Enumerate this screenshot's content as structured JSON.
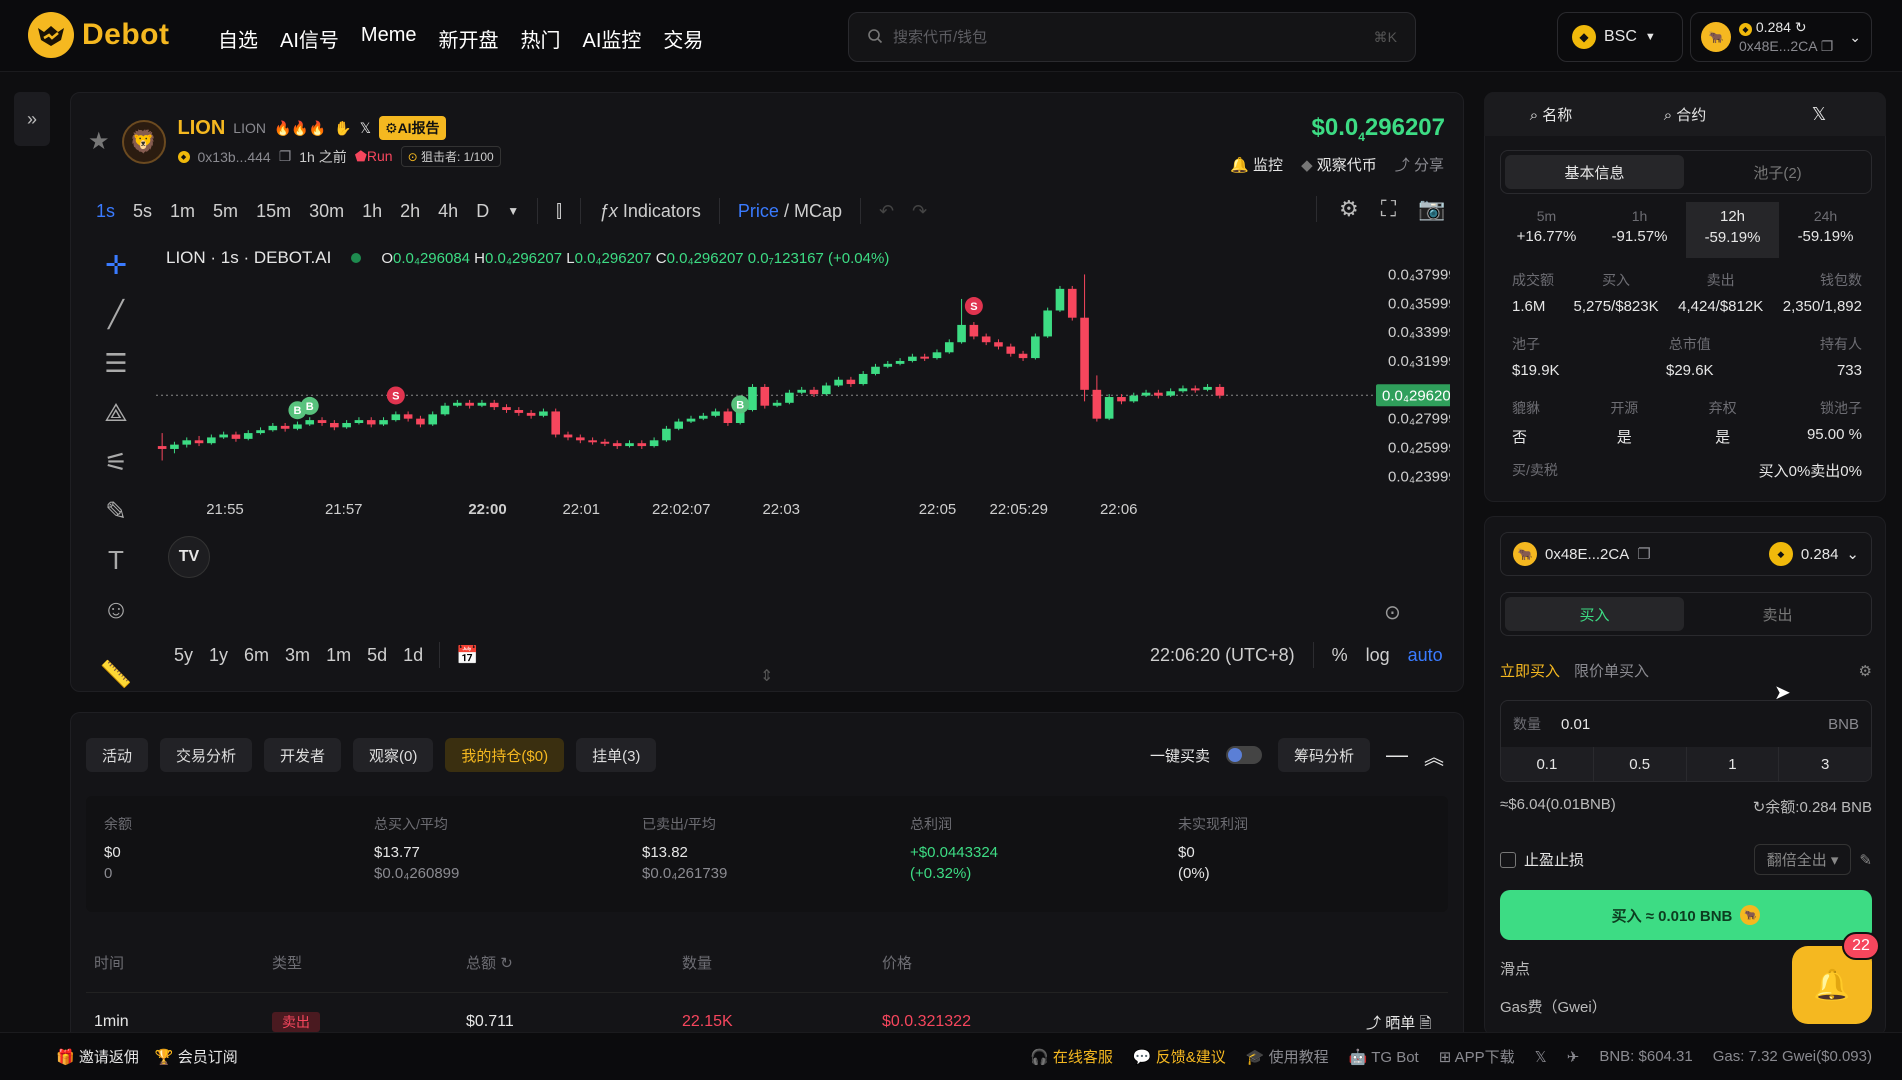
{
  "nav": {
    "logo_text": "Debot",
    "menu": [
      "自选",
      "AI信号",
      "Meme",
      "新开盘",
      "热门",
      "AI监控",
      "交易"
    ],
    "search_placeholder": "搜索代币/钱包",
    "search_shortcut": "⌘K",
    "chain": "BSC",
    "wallet_balance": "0.284",
    "wallet_addr": "0x48E...2CA"
  },
  "token": {
    "name": "LION",
    "symbol": "LION",
    "ai_report": "AI报告",
    "address": "0x13b...444",
    "age": "1h 之前",
    "run": "Run",
    "sniper": "狙击者: 1/100",
    "price": "$0.0",
    "price_sub": "4",
    "price_rest": "296207",
    "monitor": "监控",
    "watch": "观察代币",
    "share": "分享"
  },
  "toolbar": {
    "timeframes": [
      "1s",
      "5s",
      "1m",
      "5m",
      "15m",
      "30m",
      "1h",
      "2h",
      "4h",
      "D"
    ],
    "indicators": "Indicators",
    "price_label": "Price",
    "mcap_label": "MCap"
  },
  "chart_data": {
    "type": "candlestick",
    "legend": "LION · 1s · DEBOT.AI",
    "ohlc": {
      "o": "0.0₄296084",
      "h": "0.0₄296207",
      "l": "0.0₄296207",
      "c": "0.0₄296207",
      "chg": "0.0₇123167 (+0.04%)"
    },
    "y_ticks": [
      "0.0₄379999",
      "0.0₄359999",
      "0.0₄339999",
      "0.0₄319999",
      "0.0₄279999",
      "0.0₄259999",
      "0.0₄239999"
    ],
    "y_values": [
      3.79999e-05,
      3.59999e-05,
      3.39999e-05,
      3.19999e-05,
      2.79999e-05,
      2.59999e-05,
      2.39999e-05
    ],
    "last_label": "0.0₄296207",
    "last_value": 2.96207e-05,
    "x_ticks": [
      "21:55",
      "21:57",
      "22:00",
      "22:01",
      "22:02:07",
      "22:03",
      "22:05",
      "22:05:29",
      "22:06"
    ],
    "ylim": [
      2.25e-05,
      3.9e-05
    ],
    "candles": [
      [
        26.1,
        25.9,
        27.0,
        25.1
      ],
      [
        25.9,
        26.2,
        26.4,
        25.6
      ],
      [
        26.2,
        26.5,
        26.7,
        26.0
      ],
      [
        26.5,
        26.3,
        26.8,
        26.1
      ],
      [
        26.3,
        26.7,
        26.9,
        26.2
      ],
      [
        26.7,
        26.9,
        27.1,
        26.6
      ],
      [
        26.9,
        26.6,
        27.1,
        26.4
      ],
      [
        26.6,
        27.0,
        27.2,
        26.5
      ],
      [
        27.0,
        27.2,
        27.4,
        26.9
      ],
      [
        27.2,
        27.5,
        27.7,
        27.1
      ],
      [
        27.5,
        27.3,
        27.7,
        27.1
      ],
      [
        27.3,
        27.6,
        27.8,
        27.2
      ],
      [
        27.6,
        27.9,
        28.1,
        27.5
      ],
      [
        27.9,
        27.7,
        28.1,
        27.5
      ],
      [
        27.7,
        27.4,
        27.9,
        27.2
      ],
      [
        27.4,
        27.7,
        27.9,
        27.3
      ],
      [
        27.7,
        27.9,
        28.1,
        27.6
      ],
      [
        27.9,
        27.6,
        28.1,
        27.4
      ],
      [
        27.6,
        27.9,
        28.1,
        27.5
      ],
      [
        27.9,
        28.3,
        28.5,
        27.8
      ],
      [
        28.3,
        28.0,
        28.5,
        27.8
      ],
      [
        28.0,
        27.6,
        28.2,
        27.4
      ],
      [
        27.6,
        28.3,
        28.5,
        27.5
      ],
      [
        28.3,
        28.9,
        29.1,
        28.2
      ],
      [
        28.9,
        29.1,
        29.3,
        28.8
      ],
      [
        29.1,
        28.9,
        29.3,
        28.7
      ],
      [
        28.9,
        29.1,
        29.3,
        28.8
      ],
      [
        29.1,
        28.8,
        29.3,
        28.6
      ],
      [
        28.8,
        28.6,
        29.0,
        28.4
      ],
      [
        28.6,
        28.4,
        28.8,
        28.2
      ],
      [
        28.4,
        28.2,
        28.6,
        28.0
      ],
      [
        28.2,
        28.5,
        28.7,
        28.1
      ],
      [
        28.5,
        26.9,
        28.7,
        26.7
      ],
      [
        26.9,
        26.7,
        27.1,
        26.5
      ],
      [
        26.7,
        26.5,
        26.9,
        26.3
      ],
      [
        26.5,
        26.4,
        26.7,
        26.2
      ],
      [
        26.4,
        26.3,
        26.6,
        26.1
      ],
      [
        26.3,
        26.1,
        26.5,
        25.9
      ],
      [
        26.1,
        26.3,
        26.5,
        26.0
      ],
      [
        26.3,
        26.1,
        26.5,
        25.9
      ],
      [
        26.1,
        26.5,
        26.7,
        26.0
      ],
      [
        26.5,
        27.3,
        27.5,
        26.4
      ],
      [
        27.3,
        27.8,
        28.0,
        27.2
      ],
      [
        27.8,
        28.0,
        28.2,
        27.7
      ],
      [
        28.0,
        28.2,
        28.4,
        27.9
      ],
      [
        28.2,
        28.5,
        28.7,
        28.1
      ],
      [
        28.5,
        27.7,
        28.7,
        27.5
      ],
      [
        27.7,
        28.6,
        28.8,
        27.6
      ],
      [
        28.6,
        30.2,
        30.4,
        28.5
      ],
      [
        30.2,
        28.9,
        30.4,
        28.7
      ],
      [
        28.9,
        29.1,
        29.3,
        28.8
      ],
      [
        29.1,
        29.8,
        30.0,
        29.0
      ],
      [
        29.8,
        30.0,
        30.2,
        29.7
      ],
      [
        30.0,
        29.7,
        30.2,
        29.5
      ],
      [
        29.7,
        30.3,
        30.5,
        29.6
      ],
      [
        30.3,
        30.7,
        30.9,
        30.2
      ],
      [
        30.7,
        30.4,
        30.9,
        30.2
      ],
      [
        30.4,
        31.1,
        31.3,
        30.3
      ],
      [
        31.1,
        31.6,
        31.8,
        31.0
      ],
      [
        31.6,
        31.8,
        32.0,
        31.5
      ],
      [
        31.8,
        32.0,
        32.2,
        31.7
      ],
      [
        32.0,
        32.3,
        32.5,
        31.9
      ],
      [
        32.3,
        32.2,
        32.5,
        32.0
      ],
      [
        32.2,
        32.6,
        32.8,
        32.1
      ],
      [
        32.6,
        33.3,
        33.5,
        32.5
      ],
      [
        33.3,
        34.5,
        36.3,
        33.2
      ],
      [
        34.5,
        33.7,
        34.7,
        33.5
      ],
      [
        33.7,
        33.3,
        33.9,
        33.1
      ],
      [
        33.3,
        33.0,
        33.5,
        32.8
      ],
      [
        33.0,
        32.5,
        33.2,
        32.3
      ],
      [
        32.5,
        32.2,
        32.7,
        32.0
      ],
      [
        32.2,
        33.7,
        33.9,
        32.1
      ],
      [
        33.7,
        35.5,
        35.7,
        33.6
      ],
      [
        35.5,
        37.0,
        37.2,
        35.4
      ],
      [
        37.0,
        35.0,
        37.2,
        34.8
      ],
      [
        35.0,
        30.0,
        38.0,
        29.2
      ],
      [
        30.0,
        28.0,
        31.0,
        27.8
      ],
      [
        28.0,
        29.5,
        29.7,
        27.9
      ],
      [
        29.5,
        29.2,
        29.7,
        29.0
      ],
      [
        29.2,
        29.6,
        29.8,
        29.1
      ],
      [
        29.6,
        29.8,
        30.0,
        29.5
      ],
      [
        29.8,
        29.6,
        30.0,
        29.4
      ],
      [
        29.6,
        29.9,
        30.1,
        29.5
      ],
      [
        29.9,
        30.1,
        30.3,
        29.8
      ],
      [
        30.1,
        30.0,
        30.3,
        29.8
      ],
      [
        30.0,
        30.2,
        30.4,
        29.9
      ],
      [
        30.2,
        29.6,
        30.4,
        29.4
      ]
    ],
    "markers": [
      {
        "i": 11,
        "label": "B",
        "side": "buy"
      },
      {
        "i": 12,
        "label": "B",
        "side": "buy"
      },
      {
        "i": 19,
        "label": "S",
        "side": "sell"
      },
      {
        "i": 47,
        "label": "B",
        "side": "buy"
      },
      {
        "i": 66,
        "label": "S",
        "side": "sell"
      }
    ]
  },
  "chart_bottom": {
    "ranges": [
      "5y",
      "1y",
      "6m",
      "3m",
      "1m",
      "5d",
      "1d"
    ],
    "time": "22:06:20 (UTC+8)",
    "pct": "%",
    "log": "log",
    "auto": "auto"
  },
  "bottom_tabs": {
    "tabs": [
      "活动",
      "交易分析",
      "开发者",
      "观察(0)",
      "我的持仓($0)",
      "挂单(3)"
    ],
    "one_click": "一键买卖",
    "chip_analysis": "筹码分析"
  },
  "holdings": {
    "headers": [
      "余额",
      "总买入/平均",
      "已卖出/平均",
      "总利润",
      "未实现利润"
    ],
    "row1": [
      "$0",
      "$13.77",
      "$13.82",
      "+$0.0443324",
      "$0"
    ],
    "row2": [
      "0",
      "$0.0₄260899",
      "$0.0₄261739",
      "(+0.32%)",
      "(0%)"
    ]
  },
  "trades": {
    "headers": [
      "时间",
      "类型",
      "总额",
      "数量",
      "价格"
    ],
    "row": [
      "1min",
      "卖出",
      "$0.711",
      "22.15K",
      "$0.0.321322"
    ],
    "share": "晒单"
  },
  "right_info": {
    "search_tabs": [
      "名称",
      "合约"
    ],
    "tabs": [
      "基本信息",
      "池子(2)"
    ],
    "periods": [
      {
        "label": "5m",
        "value": "+16.77%"
      },
      {
        "label": "1h",
        "value": "-91.57%"
      },
      {
        "label": "12h",
        "value": "-59.19%"
      },
      {
        "label": "24h",
        "value": "-59.19%"
      }
    ],
    "r1_labels": [
      "成交额",
      "买入",
      "卖出",
      "钱包数"
    ],
    "r1_values": [
      "1.6M",
      "5,275/$823K",
      "4,424/$812K",
      "2,350/1,892"
    ],
    "r2_labels": [
      "池子",
      "总市值",
      "持有人"
    ],
    "r2_values": [
      "$19.9K",
      "$29.6K",
      "733"
    ],
    "r3_labels": [
      "貔貅",
      "开源",
      "弃权",
      "锁池子"
    ],
    "r3_values": [
      "否",
      "是",
      "是",
      "95.00 %"
    ],
    "tax_label": "买/卖税",
    "tax_value": "买入0%卖出0%"
  },
  "trade_panel": {
    "wallet": "0x48E...2CA",
    "balance": "0.284",
    "tabs": [
      "买入",
      "卖出"
    ],
    "modes": [
      "立即买入",
      "限价单买入"
    ],
    "qty_label": "数量",
    "qty_value": "0.01",
    "unit": "BNB",
    "presets": [
      "0.1",
      "0.5",
      "1",
      "3"
    ],
    "approx": "≈$6.04(0.01BNB)",
    "balance_line": "余额:0.284 BNB",
    "tp_sl": "止盈止损",
    "double_sell": "翻倍全出",
    "buy_button": "买入 ≈ 0.010  BNB",
    "slippage": "滑点",
    "gas": "Gas费（Gwei）",
    "notif_count": "22"
  },
  "footer": {
    "left": [
      "邀请返佣",
      "会员订阅"
    ],
    "right": [
      "在线客服",
      "反馈&建议",
      "使用教程",
      "TG Bot",
      "APP下载"
    ],
    "bnb": "BNB: $604.31",
    "gas": "Gas: 7.32 Gwei($0.093)"
  },
  "colors": {
    "accent": "#f5b820",
    "up": "#3ddc84",
    "down": "#f6465d",
    "blue": "#3a7bff"
  }
}
